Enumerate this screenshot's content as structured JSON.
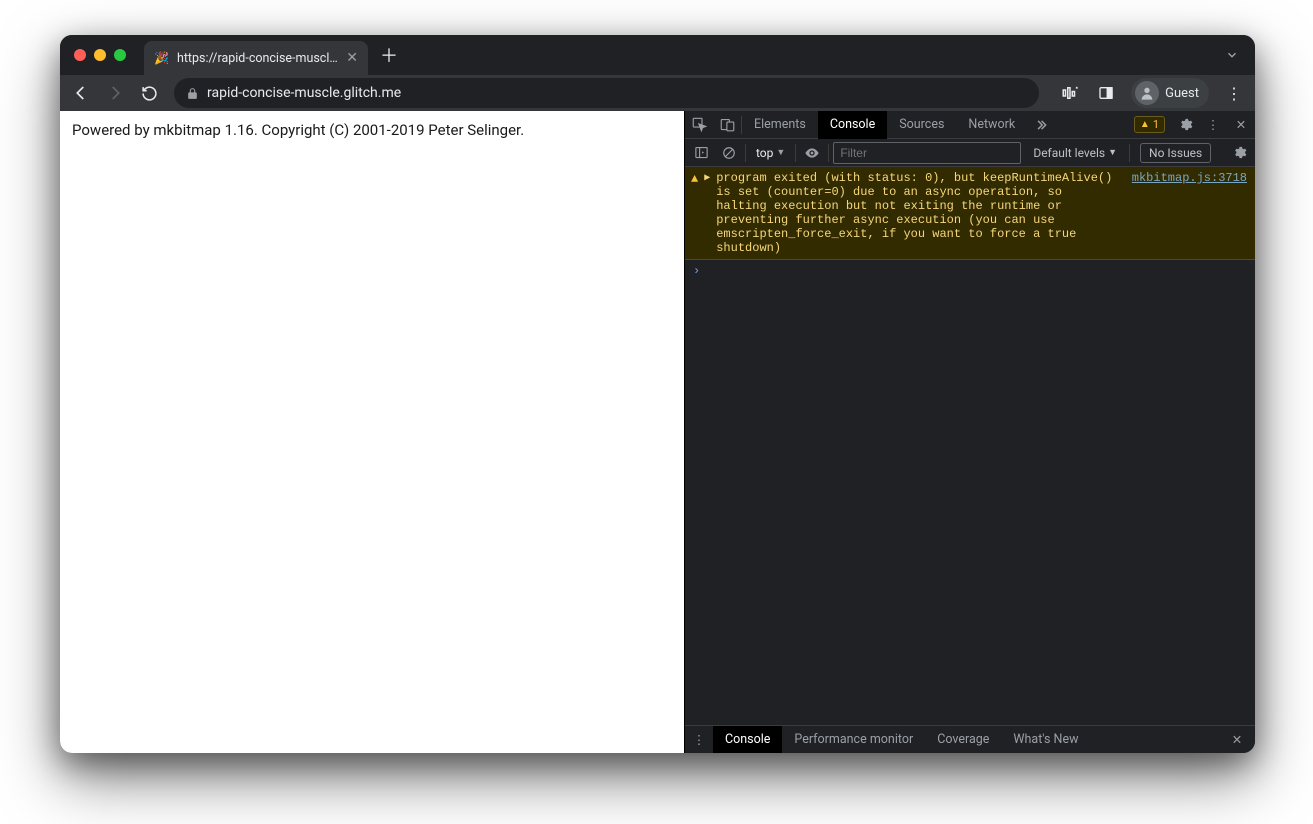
{
  "window": {
    "tab_title": "https://rapid-concise-muscle.g",
    "url_display": "rapid-concise-muscle.glitch.me",
    "guest_label": "Guest"
  },
  "page": {
    "body_text": "Powered by mkbitmap 1.16. Copyright (C) 2001-2019 Peter Selinger."
  },
  "devtools": {
    "tabs": {
      "elements": "Elements",
      "console": "Console",
      "sources": "Sources",
      "network": "Network"
    },
    "warning_count": "1",
    "console_toolbar": {
      "context_label": "top",
      "filter_placeholder": "Filter",
      "levels_label": "Default levels",
      "issues_label": "No Issues"
    },
    "console_message": {
      "text": "program exited (with status: 0), but keepRuntimeAlive() is set (counter=0) due to an async operation, so halting execution but not exiting the runtime or preventing further async execution (you can use emscripten_force_exit, if you want to force a true shutdown)",
      "source": "mkbitmap.js:3718"
    },
    "drawer_tabs": {
      "console": "Console",
      "perf_monitor": "Performance monitor",
      "coverage": "Coverage",
      "whats_new": "What's New"
    }
  }
}
